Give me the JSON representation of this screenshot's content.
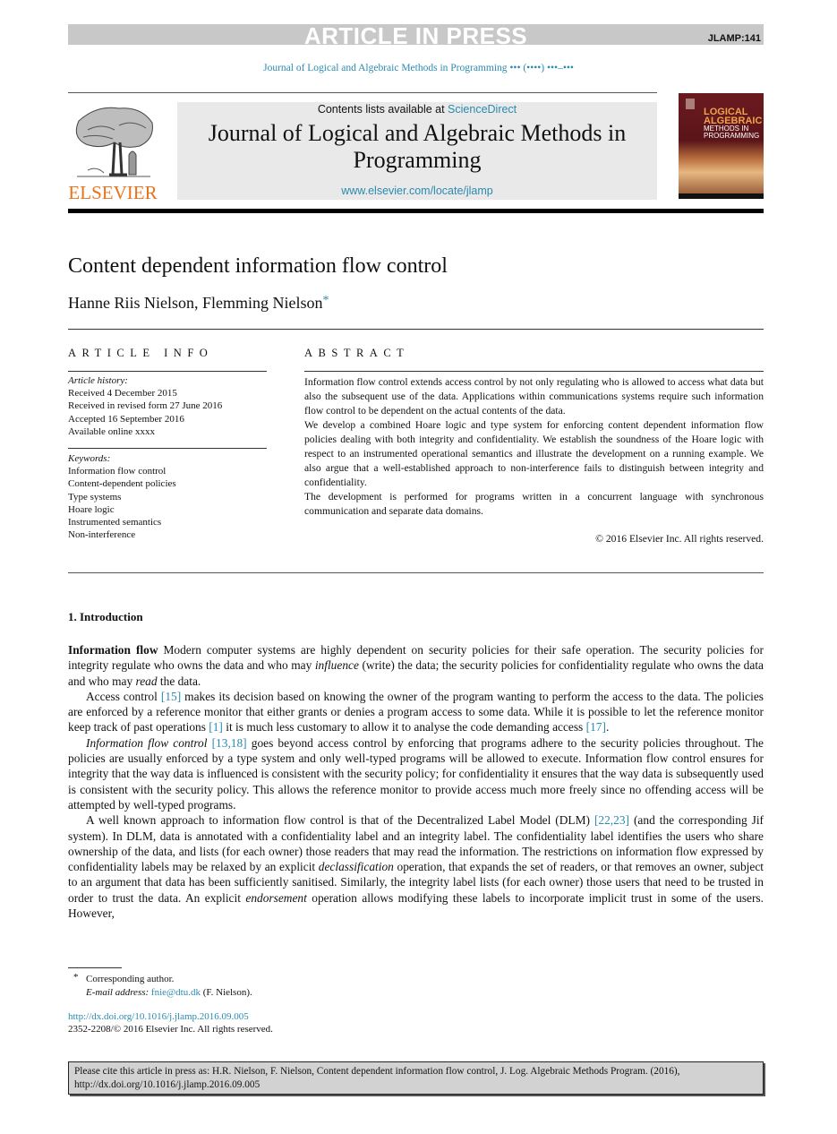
{
  "header": {
    "press_banner": "ARTICLE IN PRESS",
    "article_code": "JLAMP:141",
    "journal_runner": "Journal of Logical and Algebraic Methods in Programming ••• (••••) •••–•••"
  },
  "masthead": {
    "publisher_logo_text": "ELSEVIER",
    "contents_prefix": "Contents lists available at ",
    "contents_link": "ScienceDirect",
    "journal_title": "Journal of Logical and Algebraic Methods in Programming",
    "journal_url": "www.elsevier.com/locate/jlamp",
    "cover": {
      "title_line1": "LOGICAL",
      "title_line2": "ALGEBRAIC",
      "subtitle_line1": "METHODS IN",
      "subtitle_line2": "PROGRAMMING"
    },
    "colors": {
      "elsevier_orange": "#e8731a",
      "link_blue": "#2a8ab0",
      "cover_maroon": "#6a1a1f"
    }
  },
  "article": {
    "title": "Content dependent information flow control",
    "authors": "Hanne Riis Nielson, Flemming Nielson",
    "author_mark": "*"
  },
  "article_info": {
    "heading": "ARTICLE INFO",
    "history_label": "Article history:",
    "history": [
      "Received 4 December 2015",
      "Received in revised form 27 June 2016",
      "Accepted 16 September 2016",
      "Available online xxxx"
    ],
    "keywords_label": "Keywords:",
    "keywords": [
      "Information flow control",
      "Content-dependent policies",
      "Type systems",
      "Hoare logic",
      "Instrumented semantics",
      "Non-interference"
    ]
  },
  "abstract": {
    "heading": "ABSTRACT",
    "paragraphs": [
      "Information flow control extends access control by not only regulating who is allowed to access what data but also the subsequent use of the data. Applications within communications systems require such information flow control to be dependent on the actual contents of the data.",
      "We develop a combined Hoare logic and type system for enforcing content dependent information flow policies dealing with both integrity and confidentiality. We establish the soundness of the Hoare logic with respect to an instrumented operational semantics and illustrate the development on a running example. We also argue that a well-established approach to non-interference fails to distinguish between integrity and confidentiality.",
      "The development is performed for programs written in a concurrent language with synchronous communication and separate data domains."
    ],
    "copyright": "© 2016 Elsevier Inc. All rights reserved."
  },
  "body": {
    "section_heading": "1. Introduction",
    "p1": {
      "runin": "Information flow",
      "t1": "Modern computer systems are highly dependent on security policies for their safe operation. The security policies for integrity regulate who owns the data and who may ",
      "em1": "influence",
      "t2": " (write) the data; the security policies for confidentiality regulate who owns the data and who may ",
      "em2": "read",
      "t3": " the data."
    },
    "p2": {
      "t1": "Access control ",
      "ref1": "[15]",
      "t2": " makes its decision based on knowing the owner of the program wanting to perform the access to the data. The policies are enforced by a reference monitor that either grants or denies a program access to some data. While it is possible to let the reference monitor keep track of past operations ",
      "ref2": "[1]",
      "t3": " it is much less customary to allow it to analyse the code demanding access ",
      "ref3": "[17]",
      "t4": "."
    },
    "p3": {
      "em1": "Information flow control",
      "t1": " ",
      "ref1": "[13,18]",
      "t2": " goes beyond access control by enforcing that programs adhere to the security policies throughout. The policies are usually enforced by a type system and only well-typed programs will be allowed to execute. Information flow control ensures for integrity that the way data is influenced is consistent with the security policy; for confidentiality it ensures that the way data is subsequently used is consistent with the security policy. This allows the reference monitor to provide access much more freely since no offending access will be attempted by well-typed programs."
    },
    "p4": {
      "t1": "A well known approach to information flow control is that of the Decentralized Label Model (DLM) ",
      "ref1": "[22,23]",
      "t2": " (and the corresponding Jif system). In DLM, data is annotated with a confidentiality label and an integrity label. The confidentiality label identifies the users who share ownership of the data, and lists (for each owner) those readers that may read the information. The restrictions on information flow expressed by confidentiality labels may be relaxed by an explicit ",
      "em1": "declassification",
      "t3": " operation, that expands the set of readers, or that removes an owner, subject to an argument that data has been sufficiently sanitised. Similarly, the integrity label lists (for each owner) those users that need to be trusted in order to trust the data. An explicit ",
      "em2": "endorsement",
      "t4": " operation allows modifying these labels to incorporate implicit trust in some of the users. However,"
    }
  },
  "footnotes": {
    "star": "*",
    "corresponding": "Corresponding author.",
    "email_label": "E-mail address:",
    "email": "fnie@dtu.dk",
    "email_suffix": " (F. Nielson).",
    "doi": "http://dx.doi.org/10.1016/j.jlamp.2016.09.005",
    "issn": "2352-2208/© 2016 Elsevier Inc. All rights reserved."
  },
  "citation_box": {
    "line1": "Please cite this article in press as: H.R. Nielson, F. Nielson, Content dependent information flow control, J. Log. Algebraic Methods Program. (2016),",
    "line2": "http://dx.doi.org/10.1016/j.jlamp.2016.09.005"
  }
}
